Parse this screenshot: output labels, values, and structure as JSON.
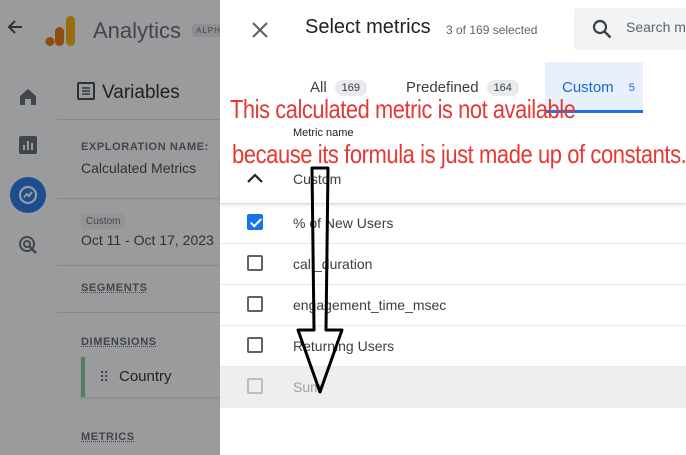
{
  "app": {
    "title": "Analytics",
    "alpha_badge": "ALPH"
  },
  "panel": {
    "heading": "Variables",
    "exploration_label": "EXPLORATION NAME:",
    "exploration_value": "Calculated Metrics",
    "date_chip": "Custom",
    "date_range": "Oct 11 - Oct 17, 2023",
    "segments_label": "SEGMENTS",
    "dimensions_label": "DIMENSIONS",
    "dimension_item": "Country",
    "metrics_label": "METRICS"
  },
  "dialog": {
    "title": "Select metrics",
    "selected_count": "3 of 169 selected",
    "search_placeholder": "Search m",
    "tabs": [
      {
        "label": "All",
        "count": "169"
      },
      {
        "label": "Predefined",
        "count": "164"
      },
      {
        "label": "Custom",
        "count": "5"
      }
    ],
    "column_header": "Metric name",
    "group_label": "Custom",
    "metrics": [
      {
        "label": "% of New Users",
        "checked": true
      },
      {
        "label": "call_duration",
        "checked": false
      },
      {
        "label": "engagement_time_msec",
        "checked": false
      },
      {
        "label": "Returning Users",
        "checked": false
      },
      {
        "label": "Sum",
        "checked": false,
        "disabled": true
      }
    ]
  },
  "annotation": {
    "line1": "This calculated metric is not available",
    "line2": "because its formula is just made up of constants.",
    "color": "#e53935"
  },
  "colors": {
    "accent": "#1a73e8",
    "logo_orange": "#f9ab00",
    "logo_dark": "#e37400"
  }
}
